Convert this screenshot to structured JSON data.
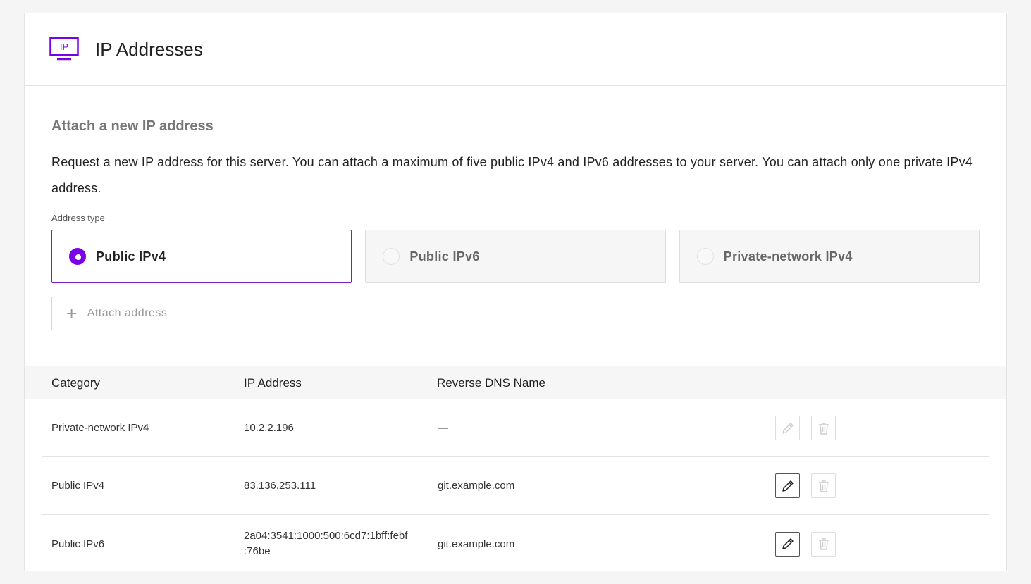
{
  "header": {
    "icon_text": "IP",
    "title": "IP Addresses"
  },
  "attach": {
    "title": "Attach a new IP address",
    "description": "Request a new IP address for this server. You can attach a maximum of five public IPv4 and IPv6 addresses to your server. You can attach only one private IPv4 address.",
    "address_type_label": "Address type",
    "options": [
      {
        "label": "Public IPv4",
        "selected": true
      },
      {
        "label": "Public IPv6",
        "selected": false
      },
      {
        "label": "Private-network IPv4",
        "selected": false
      }
    ],
    "button_label": "Attach address"
  },
  "table": {
    "columns": [
      "Category",
      "IP Address",
      "Reverse DNS Name"
    ],
    "rows": [
      {
        "category": "Private-network IPv4",
        "ip": "10.2.2.196",
        "dns": "—",
        "edit_enabled": false
      },
      {
        "category": "Public IPv4",
        "ip": "83.136.253.111",
        "dns": "git.example.com",
        "edit_enabled": true
      },
      {
        "category": "Public IPv6",
        "ip": "2a04:3541:1000:500:6cd7:1bff:febf\n:76be",
        "dns": "git.example.com",
        "edit_enabled": true
      }
    ]
  },
  "colors": {
    "accent": "#7a00e6",
    "selected_border": "#7a1fc4"
  },
  "icons": [
    "ip-monitor-icon",
    "plus-icon",
    "pencil-icon",
    "trash-icon"
  ]
}
